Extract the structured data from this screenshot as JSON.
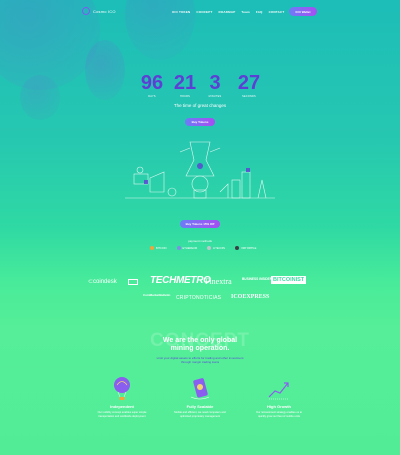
{
  "header": {
    "logo_text": "Cosmo ICO",
    "nav": [
      "ICO TOKEN",
      "CONCEPT",
      "ROADMAP",
      "Team",
      "FAQ",
      "CONTACT",
      "TOKENS"
    ],
    "wallet_button": "ICO Wallet"
  },
  "countdown": [
    {
      "value": "96",
      "label": "DAYS"
    },
    {
      "value": "21",
      "label": "HOURS"
    },
    {
      "value": "3",
      "label": "MINUTES"
    },
    {
      "value": "27",
      "label": "SECONDS"
    }
  ],
  "tagline": "The time of great changes",
  "hero_button": "Buy Tokens",
  "buy_button": "Buy Tokens 15% Off",
  "payment": {
    "label": "payment methods",
    "methods": [
      "BITCOIN",
      "ETHEREUM",
      "LITECOIN",
      "XRP RIPPLE"
    ]
  },
  "press_logos": [
    "coindesk",
    "TECHMETRO",
    "Finextra",
    "BUSINESS INSIDER",
    "BITCOINIST",
    "CoinMarketBulletin",
    "CRIPTONOTICIAS",
    "ICOEXPRESS"
  ],
  "concept": {
    "background_word": "CONCEPT",
    "headline_1": "We are the only global",
    "headline_2": "mining operation.",
    "subtext_1": "Limit your digital assets to efforts for trading and other investment",
    "subtext_2": "through margin trading loans"
  },
  "features": [
    {
      "title": "Independent",
      "desc_1": "Our mobility concept enables super simple",
      "desc_2": "transportation and worldwide deployment",
      "icon": "balloon-icon"
    },
    {
      "title": "Fully Scalable",
      "desc_1": "Mobile and efficient, we need computers and",
      "desc_2": "optimized proprietary management",
      "icon": "phone-coin-icon"
    },
    {
      "title": "High Growth",
      "desc_1": "Our reinvestment strategy enables us to",
      "desc_2": "quickly grow our fleet of mobile units",
      "icon": "growth-chart-icon"
    }
  ],
  "colors": {
    "accent": "#5e3fd6",
    "button_start": "#6b7cf7",
    "button_end": "#a84ef2"
  }
}
